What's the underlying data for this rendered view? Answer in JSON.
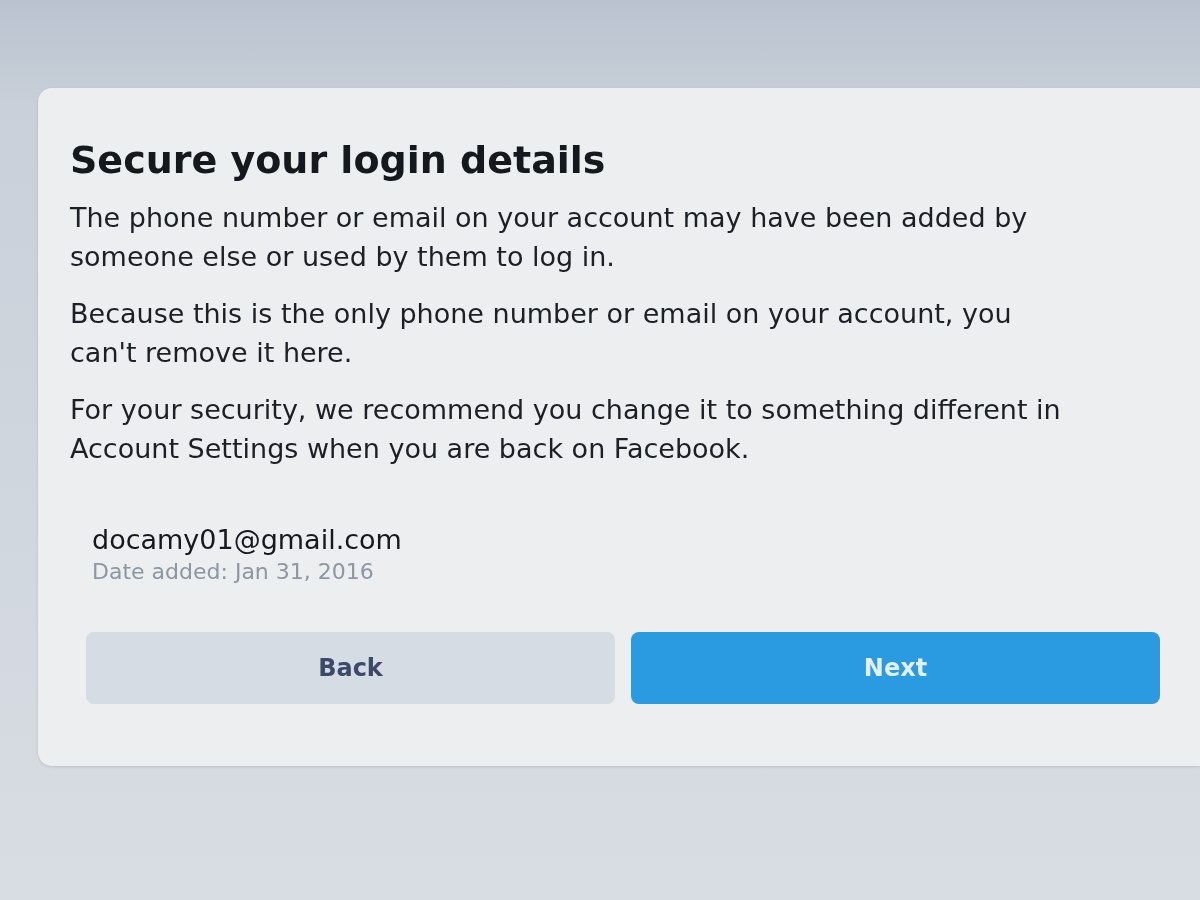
{
  "dialog": {
    "title": "Secure your login details",
    "paragraphs": [
      "The phone number or email on your account may have been added by someone else or used by them to log in.",
      "Because this is the only phone number or email on your account, you can't remove it here.",
      "For your security, we recommend you change it to something different in Account Settings when you are back on Facebook."
    ],
    "contact": {
      "value": "docamy01@gmail.com",
      "date_added": "Date added: Jan 31, 2016"
    },
    "buttons": [
      {
        "label": "Back",
        "kind": "secondary"
      },
      {
        "label": "Next",
        "kind": "primary"
      }
    ]
  }
}
